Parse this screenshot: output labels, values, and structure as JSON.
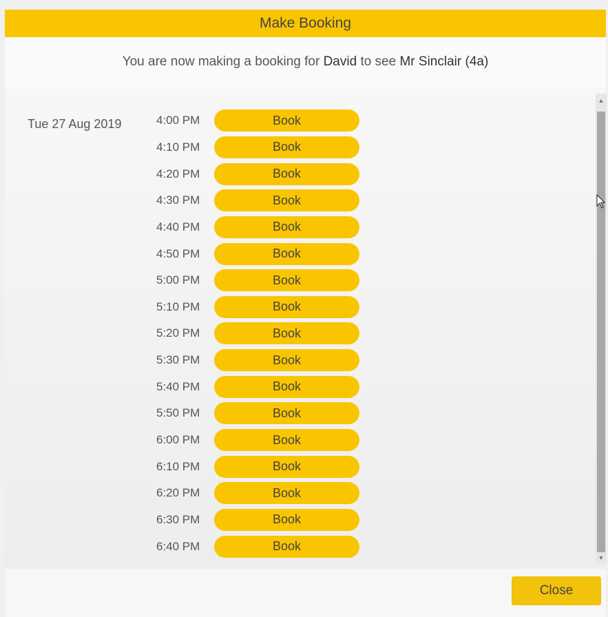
{
  "modal": {
    "title": "Make Booking",
    "intro_prefix": "You are now making a booking for",
    "student_name": "David",
    "intro_middle": "to see",
    "teacher_name": "Mr Sinclair (4a)",
    "close_label": "Close"
  },
  "schedule": {
    "date": "Tue 27 Aug 2019",
    "book_label": "Book",
    "slots": [
      "4:00 PM",
      "4:10 PM",
      "4:20 PM",
      "4:30 PM",
      "4:40 PM",
      "4:50 PM",
      "5:00 PM",
      "5:10 PM",
      "5:20 PM",
      "5:30 PM",
      "5:40 PM",
      "5:50 PM",
      "6:00 PM",
      "6:10 PM",
      "6:20 PM",
      "6:30 PM",
      "6:40 PM"
    ]
  },
  "icons": {
    "scroll_up": "caret-up-icon",
    "scroll_down": "caret-down-icon",
    "cursor": "mouse-pointer-icon"
  },
  "colors": {
    "accent": "#f9c500",
    "text": "#444444"
  }
}
